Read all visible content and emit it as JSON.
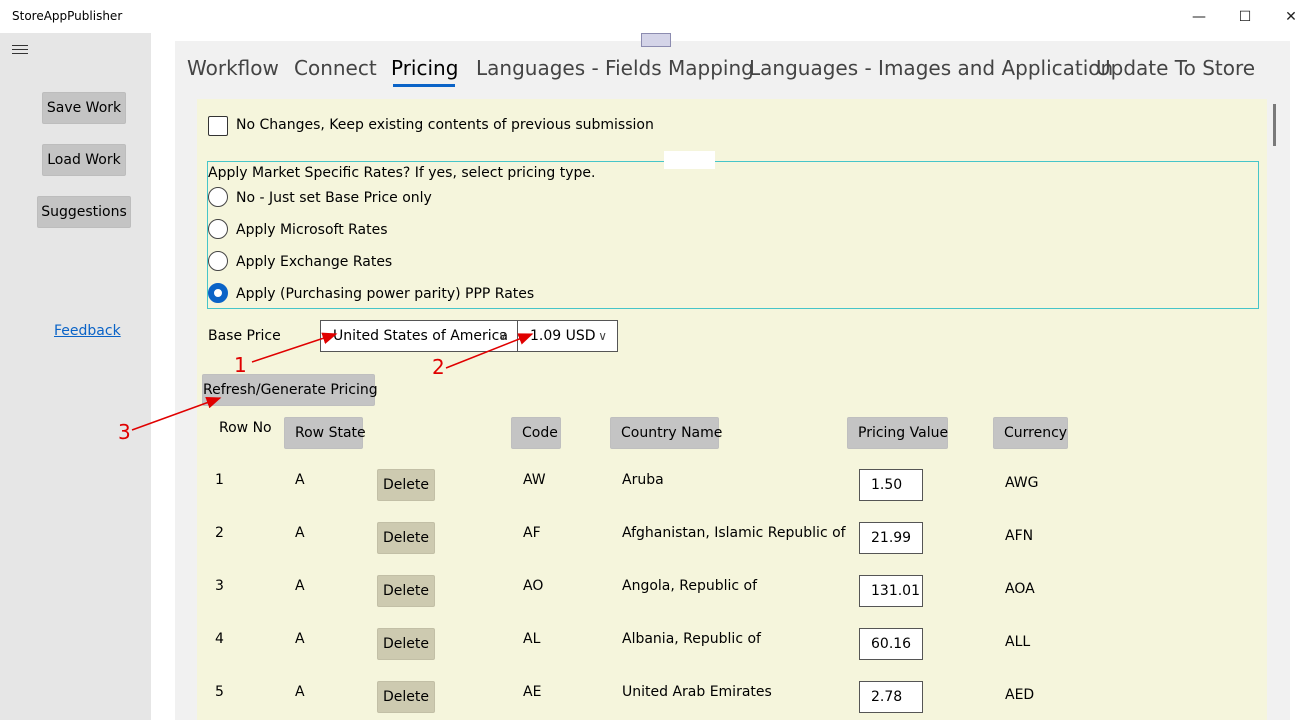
{
  "window": {
    "title": "StoreAppPublisher",
    "minimize": "—",
    "maximize": "☐",
    "close": "✕"
  },
  "sidebar": {
    "save_label": "Save Work",
    "load_label": "Load Work",
    "suggestions_label": "Suggestions",
    "feedback_label": "Feedback"
  },
  "tabs": [
    {
      "label": "Workflow"
    },
    {
      "label": "Connect"
    },
    {
      "label": "Pricing"
    },
    {
      "label": "Languages - Fields Mapping"
    },
    {
      "label": "Languages - Images and Application"
    },
    {
      "label": "Update To Store"
    }
  ],
  "pricing": {
    "no_changes_label": "No Changes, Keep existing contents of previous submission",
    "market_prompt": "Apply Market Specific Rates?  If yes, select pricing type.",
    "options": [
      {
        "label": "No - Just set Base Price only",
        "selected": false
      },
      {
        "label": "Apply Microsoft Rates",
        "selected": false
      },
      {
        "label": "Apply Exchange Rates",
        "selected": false
      },
      {
        "label": "Apply (Purchasing power parity) PPP Rates",
        "selected": true
      }
    ],
    "base_price_label": "Base Price",
    "base_country": "United States of America",
    "base_amount": "1.09 USD",
    "refresh_label": "Refresh/Generate Pricing"
  },
  "table": {
    "headers": {
      "row_no": "Row No",
      "row_state": "Row State",
      "code": "Code",
      "country_name": "Country Name",
      "pricing_value": "Pricing Value",
      "currency": "Currency"
    },
    "delete_label": "Delete",
    "rows": [
      {
        "no": "1",
        "state": "A",
        "code": "AW",
        "country": "Aruba",
        "value": "1.50",
        "currency": "AWG"
      },
      {
        "no": "2",
        "state": "A",
        "code": "AF",
        "country": "Afghanistan, Islamic Republic of",
        "value": "21.99",
        "currency": "AFN"
      },
      {
        "no": "3",
        "state": "A",
        "code": "AO",
        "country": "Angola, Republic of",
        "value": "131.01",
        "currency": "AOA"
      },
      {
        "no": "4",
        "state": "A",
        "code": "AL",
        "country": "Albania, Republic of",
        "value": "60.16",
        "currency": "ALL"
      },
      {
        "no": "5",
        "state": "A",
        "code": "AE",
        "country": "United Arab Emirates",
        "value": "2.78",
        "currency": "AED"
      }
    ]
  },
  "annotations": {
    "a1": "1",
    "a2": "2",
    "a3": "3"
  },
  "colors": {
    "accent": "#0a63c7",
    "annotation": "#e00000",
    "panel": "#f5f5dc"
  }
}
